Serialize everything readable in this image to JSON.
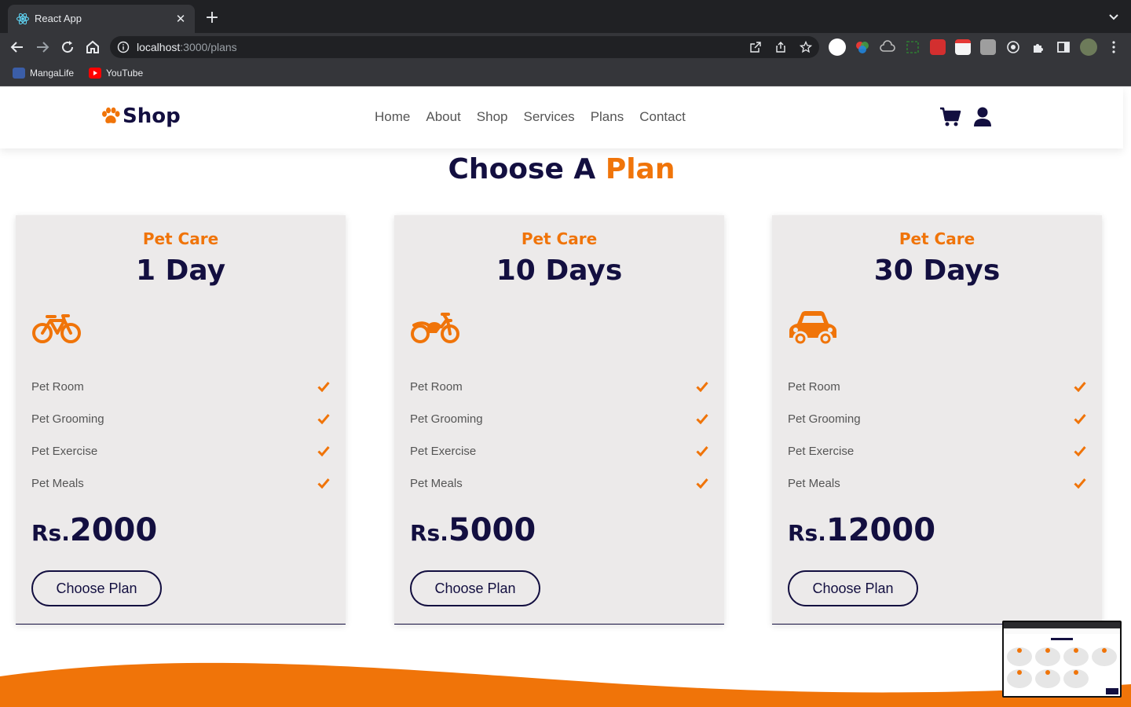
{
  "browser": {
    "tab_title": "React App",
    "url_host": "localhost",
    "url_path": ":3000/plans",
    "bookmarks": [
      {
        "label": "MangaLife"
      },
      {
        "label": "YouTube"
      }
    ]
  },
  "site": {
    "logo_text": "Shop",
    "nav": [
      "Home",
      "About",
      "Shop",
      "Services",
      "Plans",
      "Contact"
    ]
  },
  "section": {
    "title_main": "Choose A",
    "title_accent": "Plan"
  },
  "plans": [
    {
      "subtitle": "Pet Care",
      "title": "1 Day",
      "icon": "bicycle-icon",
      "features": [
        "Pet Room",
        "Pet Grooming",
        "Pet Exercise",
        "Pet Meals"
      ],
      "currency": "Rs.",
      "price": "2000",
      "button": "Choose Plan"
    },
    {
      "subtitle": "Pet Care",
      "title": "10 Days",
      "icon": "motorcycle-icon",
      "features": [
        "Pet Room",
        "Pet Grooming",
        "Pet Exercise",
        "Pet Meals"
      ],
      "currency": "Rs.",
      "price": "5000",
      "button": "Choose Plan"
    },
    {
      "subtitle": "Pet Care",
      "title": "30 Days",
      "icon": "car-icon",
      "features": [
        "Pet Room",
        "Pet Grooming",
        "Pet Exercise",
        "Pet Meals"
      ],
      "currency": "Rs.",
      "price": "12000",
      "button": "Choose Plan"
    }
  ],
  "colors": {
    "accent": "#f07409",
    "dark": "#130f40",
    "card_bg": "#eceaea"
  }
}
